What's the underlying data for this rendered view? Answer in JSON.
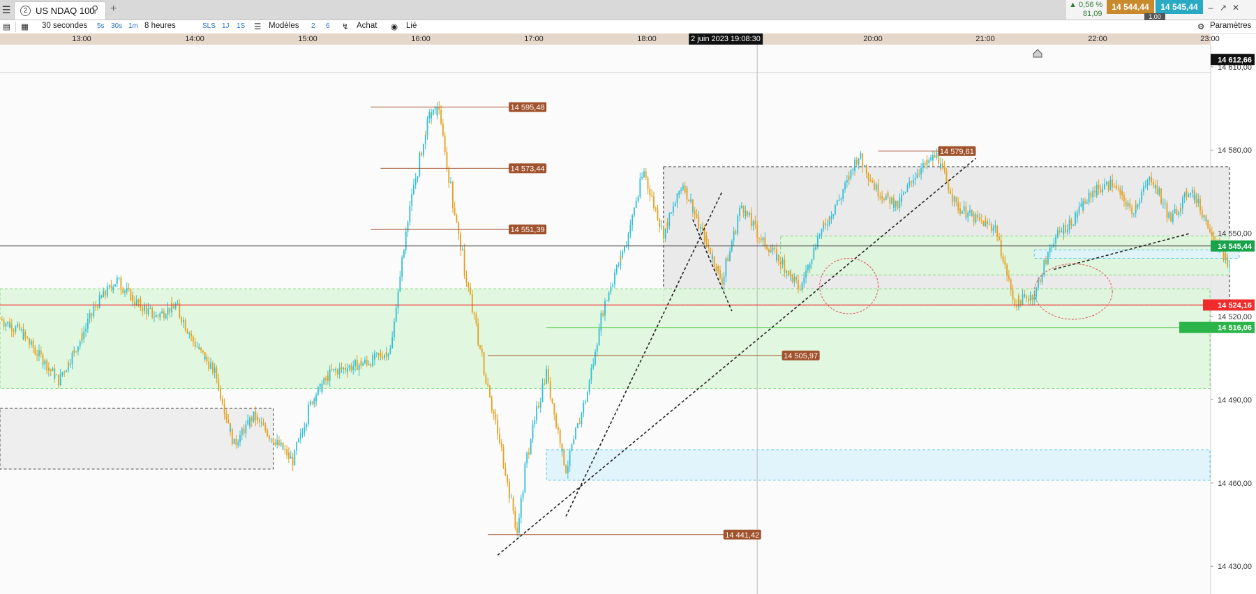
{
  "window": {
    "tab_number": "2",
    "tab_title": "US NDAQ 100",
    "search_icon": "search-icon",
    "add_tab_icon": "plus-icon",
    "menu_icon": "hamburger-icon"
  },
  "quote": {
    "change_pct": "0,56 %",
    "change_points": "81,09",
    "sell_price": "14 544,44",
    "buy_price": "14 545,44",
    "spread": "1,00",
    "up_color": "#2e7d32",
    "sell_color": "#c98a2e",
    "buy_color": "#2aa9c5"
  },
  "toolbar": {
    "interval": "30 secondes",
    "intervals": [
      "5s",
      "30s",
      "1m"
    ],
    "period": "8 heures",
    "quick": [
      "SLS",
      "1J",
      "1S"
    ],
    "models_label": "Modèles",
    "model_counts": [
      "2",
      "6"
    ],
    "order_label": "Achat",
    "link_label": "Lié",
    "settings_label": "Paramètres"
  },
  "time_axis": {
    "labels": [
      "13:00",
      "14:00",
      "15:00",
      "16:00",
      "17:00",
      "18:00",
      "20:00",
      "21:00",
      "22:00",
      "23:00"
    ],
    "cursor_label": "2 juin 2023 19:08:30"
  },
  "chart_data": {
    "type": "candlestick",
    "instrument": "US NDAQ 100",
    "interval": "30 secondes",
    "x_range": [
      "12:40",
      "23:00"
    ],
    "ylim": [
      14420,
      14618
    ],
    "y_ticks": [
      "14 430,00",
      "14 460,00",
      "14 490,00",
      "14 520,00",
      "14 550,00",
      "14 580,00",
      "14 610,00"
    ],
    "y_tick_values": [
      14430,
      14460,
      14490,
      14520,
      14550,
      14580,
      14610
    ],
    "current_price": "14 545,44",
    "current_price_value": 14545.44,
    "axis_top_label": "14 612,66",
    "axis_top_value": 14612.66,
    "red_level": "14 524,16",
    "red_level_value": 14524.16,
    "green_level": "14 516,06",
    "green_level_value": 14516.06,
    "price_path": [
      [
        "12:40",
        14519
      ],
      [
        "12:50",
        14515
      ],
      [
        "13:00",
        14506
      ],
      [
        "13:10",
        14497
      ],
      [
        "13:20",
        14510
      ],
      [
        "13:30",
        14525
      ],
      [
        "13:40",
        14533
      ],
      [
        "13:50",
        14525
      ],
      [
        "14:00",
        14520
      ],
      [
        "14:10",
        14524
      ],
      [
        "14:20",
        14510
      ],
      [
        "14:30",
        14500
      ],
      [
        "14:40",
        14474
      ],
      [
        "14:50",
        14484
      ],
      [
        "15:00",
        14476
      ],
      [
        "15:10",
        14468
      ],
      [
        "15:20",
        14490
      ],
      [
        "15:30",
        14500
      ],
      [
        "15:40",
        14502
      ],
      [
        "15:50",
        14504
      ],
      [
        "16:00",
        14508
      ],
      [
        "16:10",
        14560
      ],
      [
        "16:20",
        14592
      ],
      [
        "16:25",
        14595
      ],
      [
        "16:30",
        14570
      ],
      [
        "16:40",
        14530
      ],
      [
        "16:50",
        14495
      ],
      [
        "17:00",
        14462
      ],
      [
        "17:05",
        14441
      ],
      [
        "17:10",
        14470
      ],
      [
        "17:20",
        14500
      ],
      [
        "17:30",
        14465
      ],
      [
        "17:40",
        14490
      ],
      [
        "17:50",
        14525
      ],
      [
        "18:00",
        14545
      ],
      [
        "18:10",
        14572
      ],
      [
        "18:20",
        14550
      ],
      [
        "18:30",
        14568
      ],
      [
        "18:40",
        14550
      ],
      [
        "18:50",
        14533
      ],
      [
        "19:00",
        14560
      ],
      [
        "19:10",
        14548
      ],
      [
        "19:20",
        14540
      ],
      [
        "19:30",
        14530
      ],
      [
        "19:40",
        14550
      ],
      [
        "19:50",
        14562
      ],
      [
        "20:00",
        14578
      ],
      [
        "20:10",
        14565
      ],
      [
        "20:20",
        14560
      ],
      [
        "20:30",
        14572
      ],
      [
        "20:40",
        14578
      ],
      [
        "20:50",
        14560
      ],
      [
        "21:00",
        14555
      ],
      [
        "21:10",
        14552
      ],
      [
        "21:20",
        14525
      ],
      [
        "21:30",
        14528
      ],
      [
        "21:40",
        14548
      ],
      [
        "21:50",
        14555
      ],
      [
        "22:00",
        14565
      ],
      [
        "22:10",
        14568
      ],
      [
        "22:20",
        14558
      ],
      [
        "22:30",
        14570
      ],
      [
        "22:40",
        14555
      ],
      [
        "22:50",
        14566
      ],
      [
        "23:00",
        14552
      ],
      [
        "23:10",
        14538
      ]
    ],
    "annotations": [
      {
        "label": "14 595,48",
        "value": 14595.48,
        "from": "15:50",
        "to": "17:20"
      },
      {
        "label": "14 573,44",
        "value": 14573.44,
        "from": "15:55",
        "to": "17:20"
      },
      {
        "label": "14 551,39",
        "value": 14551.39,
        "from": "15:50",
        "to": "17:20"
      },
      {
        "label": "14 579,61",
        "value": 14579.61,
        "from": "20:10",
        "to": "21:00"
      },
      {
        "label": "14 505,97",
        "value": 14505.97,
        "from": "16:50",
        "to": "19:40"
      },
      {
        "label": "14 441,42",
        "value": 14441.42,
        "from": "16:50",
        "to": "19:10"
      }
    ],
    "zones": [
      {
        "kind": "range-box",
        "from": "18:20",
        "to": "23:10",
        "low": 14524,
        "high": 14574
      },
      {
        "kind": "green-zone",
        "from": "12:40",
        "to": "23:00",
        "low": 14494,
        "high": 14530
      },
      {
        "kind": "green-zone",
        "from": "19:20",
        "to": "23:10",
        "low": 14535,
        "high": 14549
      },
      {
        "kind": "blue-zone",
        "from": "17:20",
        "to": "23:00",
        "low": 14461,
        "high": 14472
      },
      {
        "kind": "blue-zone",
        "from": "21:30",
        "to": "23:15",
        "low": 14541,
        "high": 14544
      },
      {
        "kind": "gray-box",
        "from": "12:40",
        "to": "15:00",
        "low": 14465,
        "high": 14487
      }
    ],
    "trendlines": [
      {
        "from": [
          "16:55",
          14434
        ],
        "to": [
          "21:00",
          14577
        ]
      },
      {
        "from": [
          "17:30",
          14448
        ],
        "to": [
          "18:50",
          14565
        ]
      },
      {
        "from": [
          "18:35",
          14555
        ],
        "to": [
          "18:55",
          14522
        ]
      },
      {
        "from": [
          "21:40",
          14537
        ],
        "to": [
          "22:50",
          14550
        ]
      }
    ],
    "ellipses": [
      {
        "center": [
          "19:55",
          14531
        ],
        "rx_minutes": 15,
        "ry": 10
      },
      {
        "center": [
          "21:50",
          14529
        ],
        "rx_minutes": 20,
        "ry": 10
      }
    ],
    "cursor_time": "19:08:30",
    "colors": {
      "up": "#31bfd6",
      "down": "#e4a01c",
      "level_line": "#a0522d",
      "label_bg": "#a0522d",
      "current": "#16a34a",
      "red": "#ef2b2b",
      "green_label": "#2bb44a",
      "zone_green": "#dff6dd",
      "zone_blue": "#dff3fb",
      "range_gray": "#e6e6e6"
    }
  }
}
